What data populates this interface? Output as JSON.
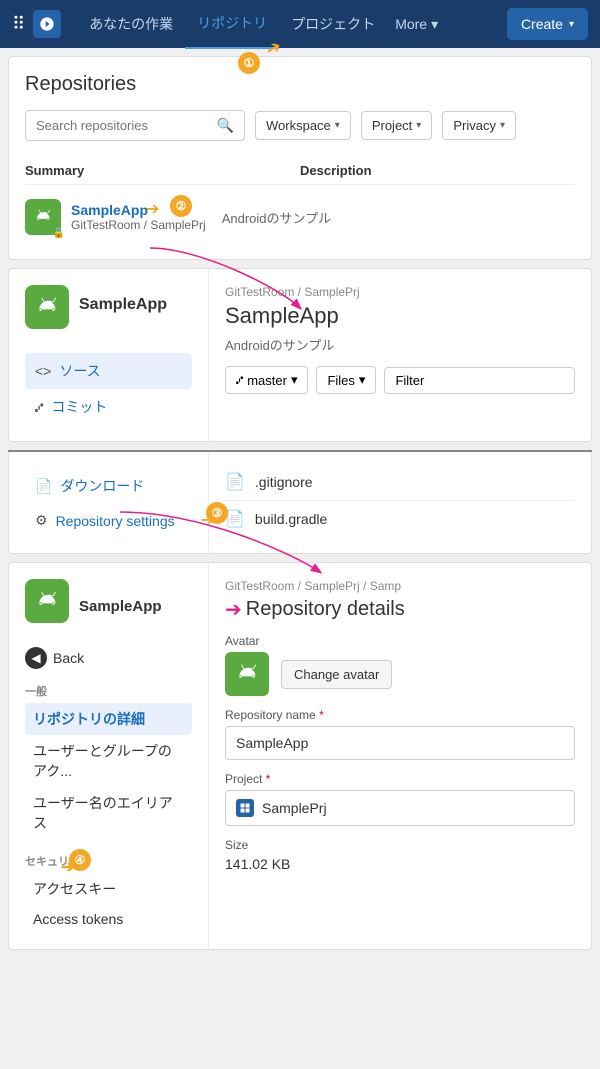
{
  "nav": {
    "links": [
      "あなたの作業",
      "リポジトリ",
      "プロジェクト"
    ],
    "active_link": "リポジトリ",
    "more_label": "More",
    "create_label": "Create"
  },
  "section1": {
    "title": "Repositories",
    "search_placeholder": "Search repositories",
    "workspace_label": "Workspace",
    "project_label": "Project",
    "privacy_label": "Privacy",
    "col_summary": "Summary",
    "col_description": "Description",
    "repo": {
      "name": "SampleApp",
      "path": "GitTestRoom / SamplePrj",
      "description": "Androidのサンプル"
    }
  },
  "section2": {
    "breadcrumb": "GitTestRoom / SamplePrj",
    "title": "SampleApp",
    "subtitle": "Androidのサンプル",
    "sidebar_title": "SampleApp",
    "nav_source": "ソース",
    "nav_commit": "コミット",
    "branch": "master",
    "files_label": "Files"
  },
  "section3": {
    "nav_download": "ダウンロード",
    "nav_repo_settings": "Repository settings",
    "files": [
      ".gitignore",
      "build.gradle"
    ]
  },
  "section4": {
    "breadcrumb": "GitTestRoom / SamplePrj / Samp",
    "title": "Repository details",
    "sidebar_title": "SampleApp",
    "back_label": "Back",
    "section_general": "一般",
    "nav_repo_detail": "リポジトリの詳細",
    "nav_user_group": "ユーザーとグループのアク...",
    "nav_user_alias": "ユーザー名のエイリアス",
    "section_security": "セキュリティ",
    "nav_access_key": "アクセスキー",
    "nav_access_tokens": "Access tokens",
    "avatar_label": "Avatar",
    "change_avatar": "Change avatar",
    "repo_name_label": "Repository name",
    "repo_name_value": "SampleApp",
    "project_label": "Project",
    "project_value": "SamplePrj",
    "size_label": "Size",
    "size_value": "141.02 KB"
  },
  "annotations": {
    "1": "①",
    "2": "②",
    "3": "③",
    "4": "④"
  }
}
